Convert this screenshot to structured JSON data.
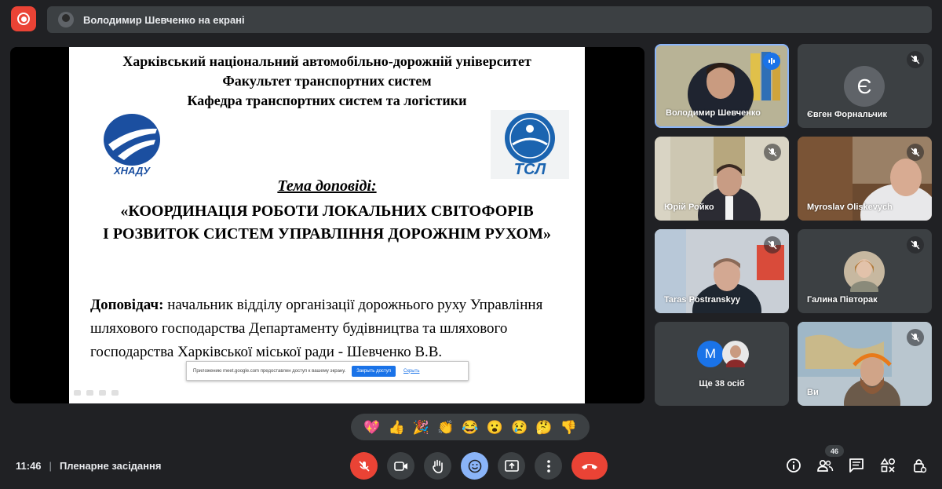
{
  "top_bar": {
    "presenting_text": "Володимир Шевченко на екрані"
  },
  "slide": {
    "header_lines": [
      "Харківський національний автомобільно-дорожній університет",
      "Факультет транспортних систем",
      "Кафедра транспортних систем та логістики"
    ],
    "logo_left_text": "ХНАДУ",
    "logo_right_text": "ТСЛ",
    "topic_label": "Тема доповіді:",
    "title_lines": [
      "«КООРДИНАЦІЯ РОБОТИ ЛОКАЛЬНИХ СВІТОФОРІВ",
      "І РОЗВИТОК СИСТЕМ УПРАВЛІННЯ ДОРОЖНІМ РУХОМ»"
    ],
    "speaker_label": "Доповідач:",
    "speaker_text": " начальник відділу організації дорожнього руху Управління шляхового господарства Департаменту будівництва та шляхового господарства Харківської міської ради - Шевченко В.В."
  },
  "share_notice": {
    "text": "Приложению meet.google.com предоставлен доступ к вашему экрану.",
    "stop_label": "Закрыть доступ",
    "hide_label": "Скрыть"
  },
  "participants": [
    {
      "name": "Володимир Шевченко",
      "speaking": true
    },
    {
      "name": "Євген Форнальчик",
      "initial": "Є",
      "avatar_color": "#5f6368"
    },
    {
      "name": "Юрій Ройко"
    },
    {
      "name": "Myroslav Oliskevych"
    },
    {
      "name": "Taras Postranskyy"
    },
    {
      "name": "Галина Півторак"
    },
    {
      "name": "Ще 38 осіб",
      "initial": "M",
      "avatar_color": "#1a73e8"
    },
    {
      "name": "Ви"
    }
  ],
  "reactions": [
    "💖",
    "👍",
    "🎉",
    "👏",
    "😂",
    "😮",
    "😢",
    "🤔",
    "👎"
  ],
  "bottom": {
    "time": "11:46",
    "meeting_name": "Пленарне засідання",
    "participant_count": "46"
  },
  "colors": {
    "background": "#202124",
    "tile": "#3c4043",
    "danger": "#ea4335",
    "accent": "#8ab4f8",
    "blue": "#1a73e8"
  },
  "icons": {
    "controls": [
      "mic-off-icon",
      "camera-icon",
      "raise-hand-icon",
      "emoji-icon",
      "present-icon",
      "more-icon",
      "end-call-icon"
    ],
    "right": [
      "info-icon",
      "people-icon",
      "chat-icon",
      "activities-icon",
      "host-controls-icon"
    ]
  }
}
